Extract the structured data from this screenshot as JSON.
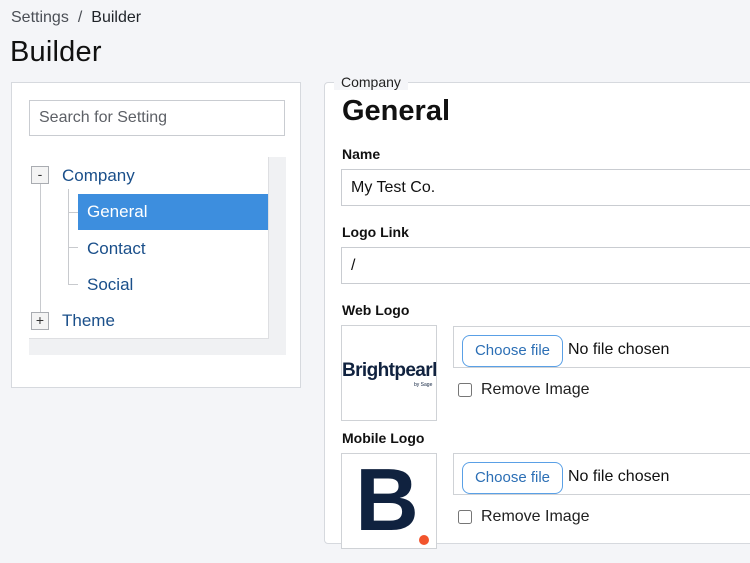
{
  "breadcrumb": {
    "root": "Settings",
    "separator": "/",
    "current": "Builder"
  },
  "page_title": "Builder",
  "search": {
    "placeholder": "Search for Setting",
    "value": ""
  },
  "tree": {
    "company": {
      "toggle": "-",
      "label": "Company"
    },
    "children": [
      {
        "label": "General",
        "selected": true
      },
      {
        "label": "Contact",
        "selected": false
      },
      {
        "label": "Social",
        "selected": false
      }
    ],
    "theme": {
      "toggle": "+",
      "label": "Theme"
    }
  },
  "form": {
    "legend": "Company",
    "title": "General",
    "name": {
      "label": "Name",
      "value": "My Test Co."
    },
    "logo_link": {
      "label": "Logo Link",
      "value": "/"
    },
    "web_logo": {
      "label": "Web Logo",
      "logo_text": "Brightpearl",
      "logo_subtext": "by Sage",
      "choose_label": "Choose file",
      "no_file_text": "No file chosen",
      "remove_label": "Remove Image",
      "remove_checked": false
    },
    "mobile_logo": {
      "label": "Mobile Logo",
      "logo_letter": "B",
      "choose_label": "Choose file",
      "no_file_text": "No file chosen",
      "remove_label": "Remove Image",
      "remove_checked": false
    }
  },
  "colors": {
    "accent": "#3d8ede",
    "link": "#1a4f8a",
    "brand_navy": "#10223f",
    "brand_dot": "#f2542d"
  }
}
